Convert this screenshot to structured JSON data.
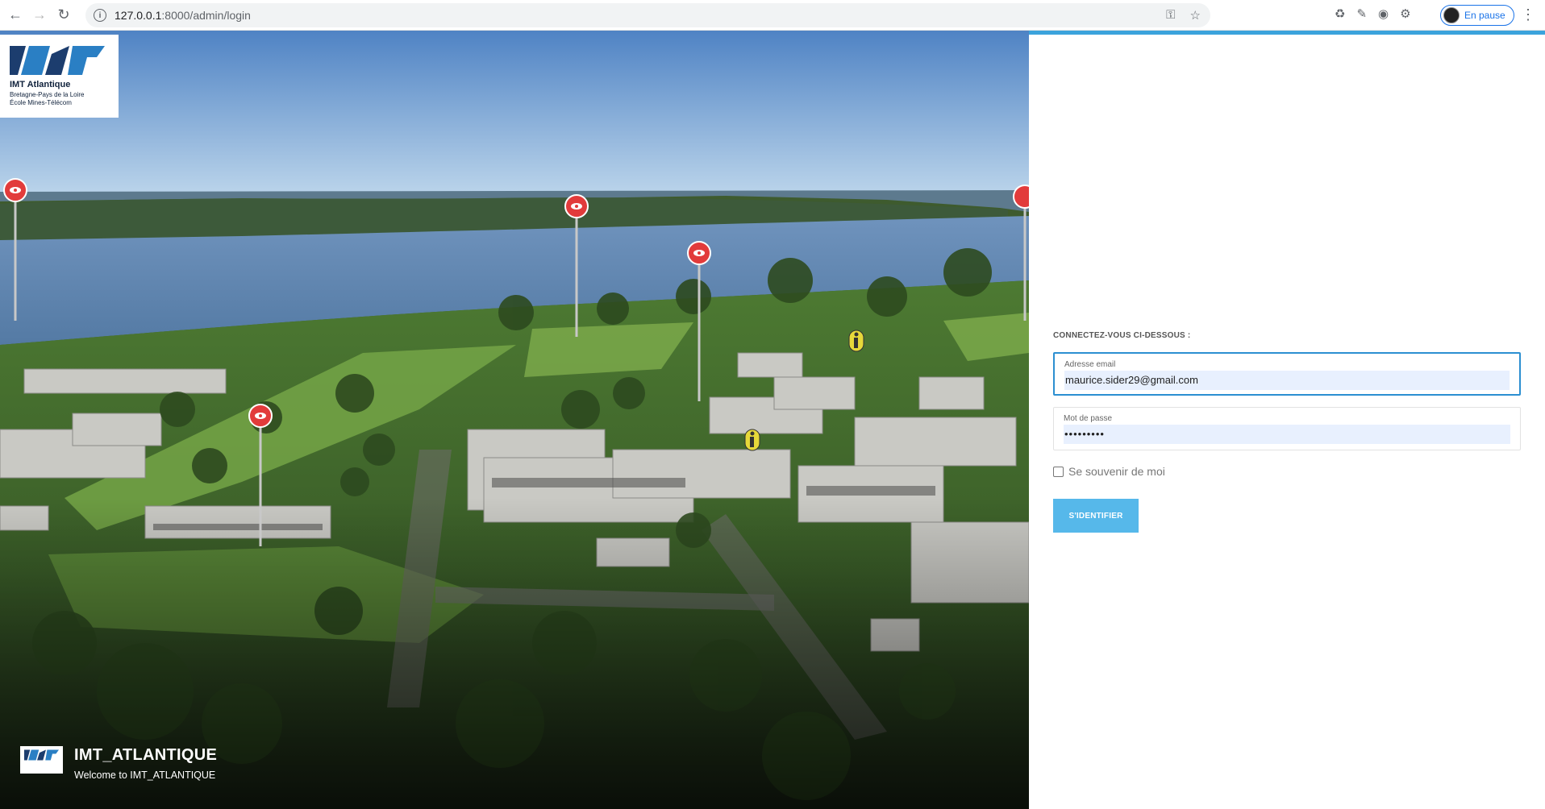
{
  "browser": {
    "url_host": "127.0.0.1",
    "url_path": ":8000/admin/login",
    "profile_label": "En pause",
    "icons": [
      "back-icon",
      "forward-icon",
      "reload-icon",
      "info-icon",
      "key-icon",
      "star-icon",
      "recycle-icon",
      "pen-extension-icon",
      "shield-extension-icon",
      "puzzle-extensions-icon",
      "menu-dots-icon"
    ]
  },
  "hero": {
    "logo_name": "IMT Atlantique",
    "logo_sub1": "Bretagne-Pays de la Loire",
    "logo_sub2": "École Mines-Télécom",
    "brand_title": "IMT_ATLANTIQUE",
    "brand_welcome": "Welcome to IMT_ATLANTIQUE"
  },
  "login": {
    "heading": "CONNECTEZ-VOUS CI-DESSOUS :",
    "email_label": "Adresse email",
    "email_value": "maurice.sider29@gmail.com",
    "password_label": "Mot de passe",
    "password_value": "•••••••••",
    "remember_label": "Se souvenir de moi",
    "submit_label": "S'IDENTIFIER"
  },
  "colors": {
    "accent": "#3ba3dc",
    "button": "#56b8ea",
    "autofill": "#e8f0fe",
    "focus_border": "#2c8fd1"
  }
}
